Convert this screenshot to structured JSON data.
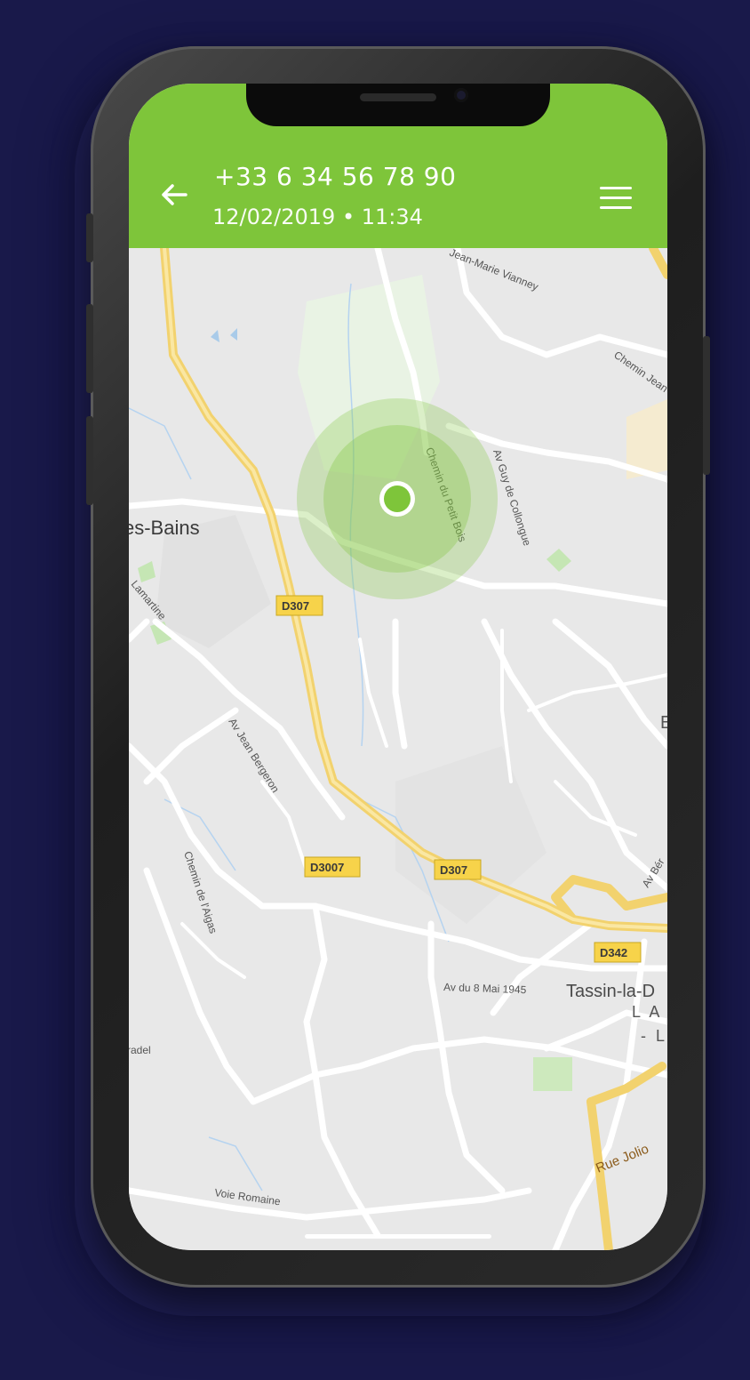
{
  "header": {
    "back_icon": "arrow-left-icon",
    "phone_number": "+33 6 34 56 78 90",
    "datetime": "12/02/2019 • 11:34",
    "menu_icon": "hamburger-menu-icon",
    "color": "#7ec53a"
  },
  "map": {
    "labels": {
      "place_bains": "es-Bains",
      "place_tassin": "Tassin-la-D",
      "place_la": "L A",
      "place_l": "- L",
      "road_jean_marie": "Jean-Marie Vianney",
      "road_chemin_jean": "Chemin Jean",
      "road_petit_bois": "Chemin du Petit Bois",
      "road_guy": "Av Guy de Collongue",
      "road_lamartine": "Lamartine",
      "road_bergeron": "Av Jean Bergeron",
      "road_aigas": "Chemin de l'Aigas",
      "road_8mai": "Av du 8 Mai 1945",
      "road_pradel": "Pradel",
      "road_romaine": "Voie Romaine",
      "road_joliot": "Rue Jolio",
      "road_ber": "Av Bér",
      "place_e": "E"
    },
    "badges": {
      "d307_a": "D307",
      "d3007": "D3007",
      "d307_b": "D307",
      "d342": "D342"
    },
    "location_marker": "location-dot",
    "accuracy_color": "#7ec53a"
  }
}
